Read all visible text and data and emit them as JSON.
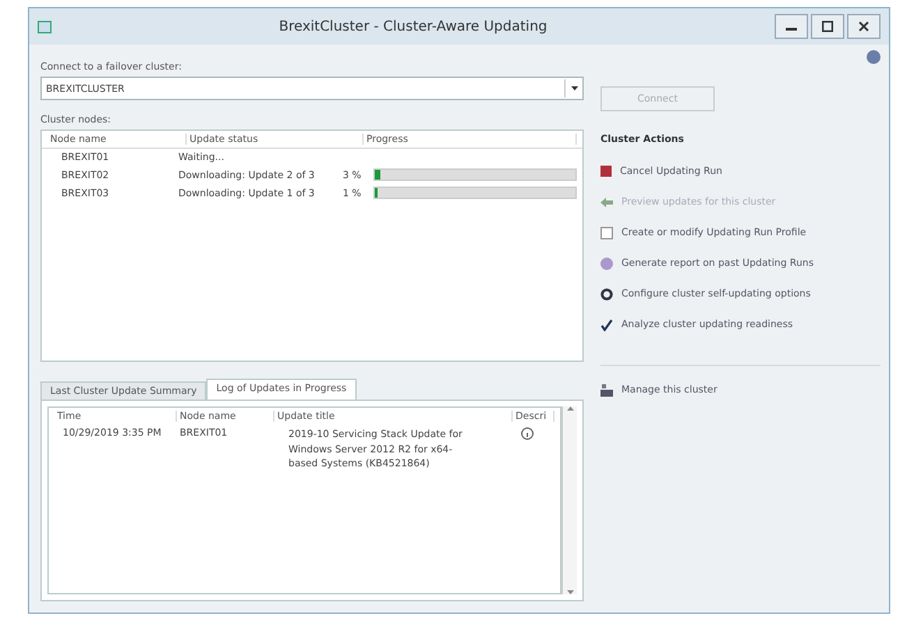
{
  "window": {
    "title": "BrexitCluster - Cluster-Aware Updating"
  },
  "connect": {
    "label": "Connect to a failover cluster:",
    "value": "BREXITCLUSTER",
    "button": {
      "label": "Connect",
      "disabled": true
    }
  },
  "nodes": {
    "label": "Cluster nodes:",
    "columns": [
      "Node name",
      "Update status",
      "Progress"
    ],
    "rows": [
      {
        "node": "BREXIT01",
        "status": "Waiting..."
      },
      {
        "node": "BREXIT02",
        "status": "Downloading: Update 2 of 3",
        "progress": "3 %",
        "level": 0.03
      },
      {
        "node": "BREXIT03",
        "status": "Downloading: Update 1 of 3",
        "progress": "1 %",
        "level": 0.01
      }
    ]
  },
  "actions": {
    "title": "Cluster Actions",
    "items": [
      {
        "kind": "stop",
        "label": "Cancel Updating Run",
        "disabled": false
      },
      {
        "kind": "preview",
        "label": "Preview updates for this cluster",
        "disabled": true
      },
      {
        "kind": "profile",
        "label": "Create or modify Updating Run Profile",
        "disabled": false
      },
      {
        "kind": "report",
        "label": "Generate report on past Updating Runs",
        "disabled": false
      },
      {
        "kind": "options",
        "label": "Configure cluster self-updating options",
        "disabled": false
      },
      {
        "kind": "analyze",
        "label": "Analyze cluster updating readiness",
        "disabled": false
      }
    ],
    "manage": "Manage this cluster"
  },
  "tabs": [
    {
      "label": "Last Cluster Update Summary",
      "selected": false
    },
    {
      "label": "Log of Updates in Progress",
      "selected": true
    }
  ],
  "log": {
    "columns": [
      "Time",
      "Node name",
      "Update title",
      "Descri"
    ],
    "rows": [
      {
        "time": "10/29/2019 3:35 PM",
        "node": "BREXIT01",
        "title": "2019-10 Servicing Stack Update for Windows Server 2012 R2 for x64-based Systems (KB4521864)"
      }
    ]
  }
}
